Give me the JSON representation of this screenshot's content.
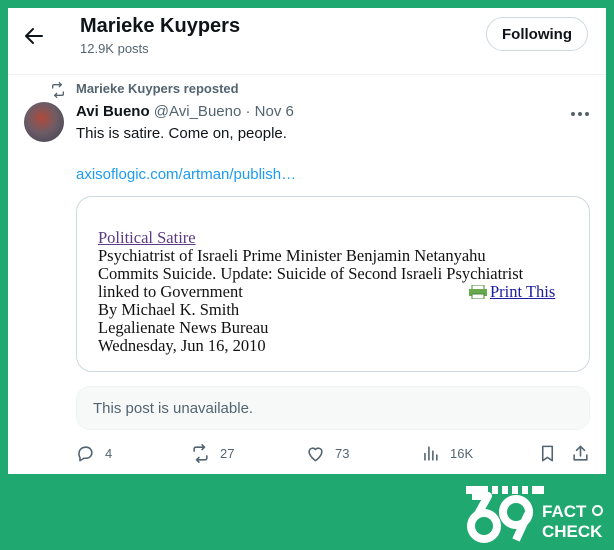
{
  "header": {
    "back_icon": "arrow-left-icon",
    "profile_name": "Marieke Kuypers",
    "post_count": "12.9K posts",
    "follow_label": "Following"
  },
  "repost": {
    "text": "Marieke Kuypers reposted",
    "icon": "repost-icon"
  },
  "tweet": {
    "author_name": "Avi Bueno",
    "handle": "@Avi_Bueno",
    "separator": "·",
    "date": "Nov 6",
    "text": "This is satire. Come on, people.",
    "link": "axisoflogic.com/artman/publish…",
    "more_icon": "more-icon"
  },
  "card": {
    "category": "Political Satire",
    "lines": [
      "Psychiatrist of Israeli Prime Minister Benjamin Netanyahu",
      "Commits Suicide. Update: Suicide of Second Israeli Psychiatrist",
      "linked to Government"
    ],
    "print_label": "Print This",
    "byline": "By Michael K. Smith",
    "bureau": "Legalienate News Bureau",
    "dateline": "Wednesday, Jun 16, 2010"
  },
  "quoted": {
    "unavailable_text": "This post is unavailable."
  },
  "actions": {
    "replies": "4",
    "reposts": "27",
    "likes": "73",
    "views": "16K"
  },
  "watermark": {
    "number": "69",
    "line1": "FACT",
    "line2": "CHECK"
  },
  "colors": {
    "background": "#1fa870",
    "link": "#1d9bf0",
    "muted": "#536471",
    "text": "#0f1419"
  }
}
